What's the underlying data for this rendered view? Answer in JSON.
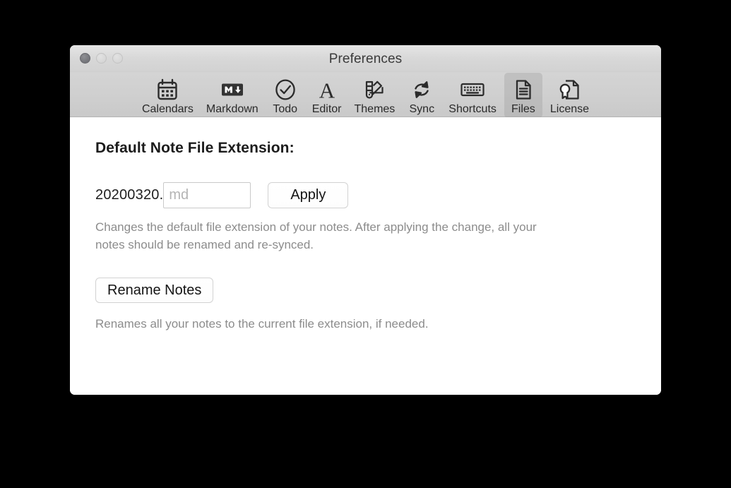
{
  "window": {
    "title": "Preferences",
    "traffic_lights": [
      {
        "name": "close",
        "label": "Close"
      },
      {
        "name": "minimize",
        "label": "Minimize"
      },
      {
        "name": "zoom",
        "label": "Zoom"
      }
    ]
  },
  "toolbar": {
    "items": [
      {
        "label": "Calendars",
        "icon": "calendar-icon",
        "selected": false
      },
      {
        "label": "Markdown",
        "icon": "markdown-icon",
        "selected": false
      },
      {
        "label": "Todo",
        "icon": "check-circle-icon",
        "selected": false
      },
      {
        "label": "Editor",
        "icon": "letter-a-icon",
        "selected": false
      },
      {
        "label": "Themes",
        "icon": "swatch-icon",
        "selected": false
      },
      {
        "label": "Sync",
        "icon": "sync-icon",
        "selected": false
      },
      {
        "label": "Shortcuts",
        "icon": "keyboard-icon",
        "selected": false
      },
      {
        "label": "Files",
        "icon": "document-icon",
        "selected": true
      },
      {
        "label": "License",
        "icon": "certificate-icon",
        "selected": false
      }
    ]
  },
  "main": {
    "heading": "Default Note File Extension:",
    "extension_row": {
      "prefix": "20200320.",
      "input_value": "",
      "input_placeholder": "md",
      "apply_label": "Apply"
    },
    "extension_help": "Changes the default file extension of your notes. After applying the change, all your notes should be renamed and re-synced.",
    "rename_label": "Rename Notes",
    "rename_help": "Renames all your notes to the current file extension, if needed."
  },
  "colors": {
    "titlebar_top": "#e5e5e5",
    "titlebar_bottom": "#d2d2d2",
    "toolbar": "#cfcfcf",
    "selected_tab": "#a0a0a0",
    "content_bg": "#ffffff",
    "help_text": "#8c8c8c",
    "placeholder": "#b4b4b4",
    "backdrop": "#000000"
  }
}
